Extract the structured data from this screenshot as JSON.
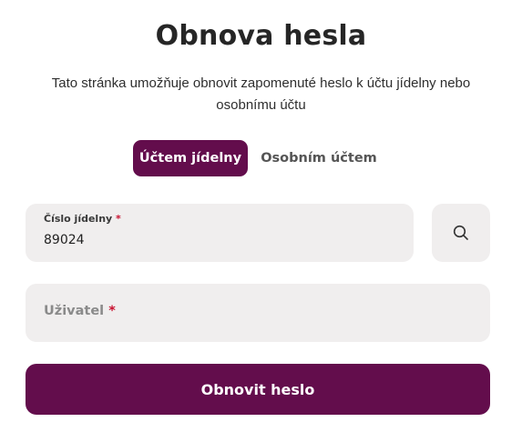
{
  "page": {
    "title": "Obnova hesla",
    "description": "Tato stránka umožňuje obnovit zapomenuté heslo k účtu jídelny nebo osobnímu účtu"
  },
  "tabs": [
    {
      "label": "Účtem jídelny",
      "active": true
    },
    {
      "label": "Osobním účtem",
      "active": false
    }
  ],
  "form": {
    "canteen_number": {
      "label": "Číslo jídelny",
      "required_mark": "*",
      "value": "89024"
    },
    "search_icon": "search-icon",
    "user": {
      "placeholder": "Uživatel",
      "required_mark": "*",
      "value": ""
    },
    "submit_label": "Obnovit heslo"
  },
  "colors": {
    "accent": "#630d4c",
    "field_bg": "#f0eeee",
    "required": "#c8102e"
  }
}
